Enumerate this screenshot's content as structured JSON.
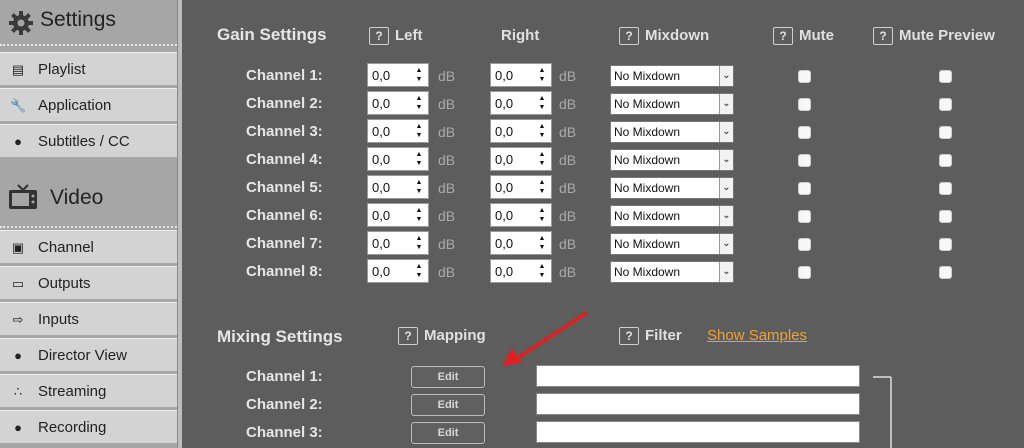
{
  "sidebar": {
    "settings_header": "Settings",
    "settings_items": [
      {
        "label": "Playlist",
        "icon": "playlist-icon"
      },
      {
        "label": "Application",
        "icon": "wrench-icon"
      },
      {
        "label": "Subtitles / CC",
        "icon": "speech-bubble-icon"
      }
    ],
    "video_header": "Video",
    "video_items": [
      {
        "label": "Channel",
        "icon": "tv-icon"
      },
      {
        "label": "Outputs",
        "icon": "monitor-icon"
      },
      {
        "label": "Inputs",
        "icon": "input-plug-icon"
      },
      {
        "label": "Director View",
        "icon": "person-icon"
      },
      {
        "label": "Streaming",
        "icon": "rss-icon"
      },
      {
        "label": "Recording",
        "icon": "record-dot-icon"
      }
    ]
  },
  "gain": {
    "title": "Gain Settings",
    "col_left": "Left",
    "col_right": "Right",
    "col_mixdown": "Mixdown",
    "col_mute": "Mute",
    "col_mute_preview": "Mute Preview",
    "help_glyph": "?",
    "unit": "dB",
    "rows": [
      {
        "label": "Channel 1:",
        "left": "0,0",
        "right": "0,0",
        "mixdown": "No Mixdown"
      },
      {
        "label": "Channel 2:",
        "left": "0,0",
        "right": "0,0",
        "mixdown": "No Mixdown"
      },
      {
        "label": "Channel 3:",
        "left": "0,0",
        "right": "0,0",
        "mixdown": "No Mixdown"
      },
      {
        "label": "Channel 4:",
        "left": "0,0",
        "right": "0,0",
        "mixdown": "No Mixdown"
      },
      {
        "label": "Channel 5:",
        "left": "0,0",
        "right": "0,0",
        "mixdown": "No Mixdown"
      },
      {
        "label": "Channel 6:",
        "left": "0,0",
        "right": "0,0",
        "mixdown": "No Mixdown"
      },
      {
        "label": "Channel 7:",
        "left": "0,0",
        "right": "0,0",
        "mixdown": "No Mixdown"
      },
      {
        "label": "Channel 8:",
        "left": "0,0",
        "right": "0,0",
        "mixdown": "No Mixdown"
      }
    ]
  },
  "mixing": {
    "title": "Mixing Settings",
    "col_mapping": "Mapping",
    "col_filter": "Filter",
    "show_samples": "Show Samples",
    "edit_label": "Edit",
    "rows": [
      {
        "label": "Channel 1:",
        "filter_value": ""
      },
      {
        "label": "Channel 2:",
        "filter_value": ""
      },
      {
        "label": "Channel 3:",
        "filter_value": ""
      }
    ]
  },
  "colors": {
    "background": "#5d5d5d",
    "sidebar": "#a6a6a6",
    "sidebar_item": "#d3d3d3",
    "link": "#f0a030",
    "annotation_arrow": "#e02020"
  }
}
